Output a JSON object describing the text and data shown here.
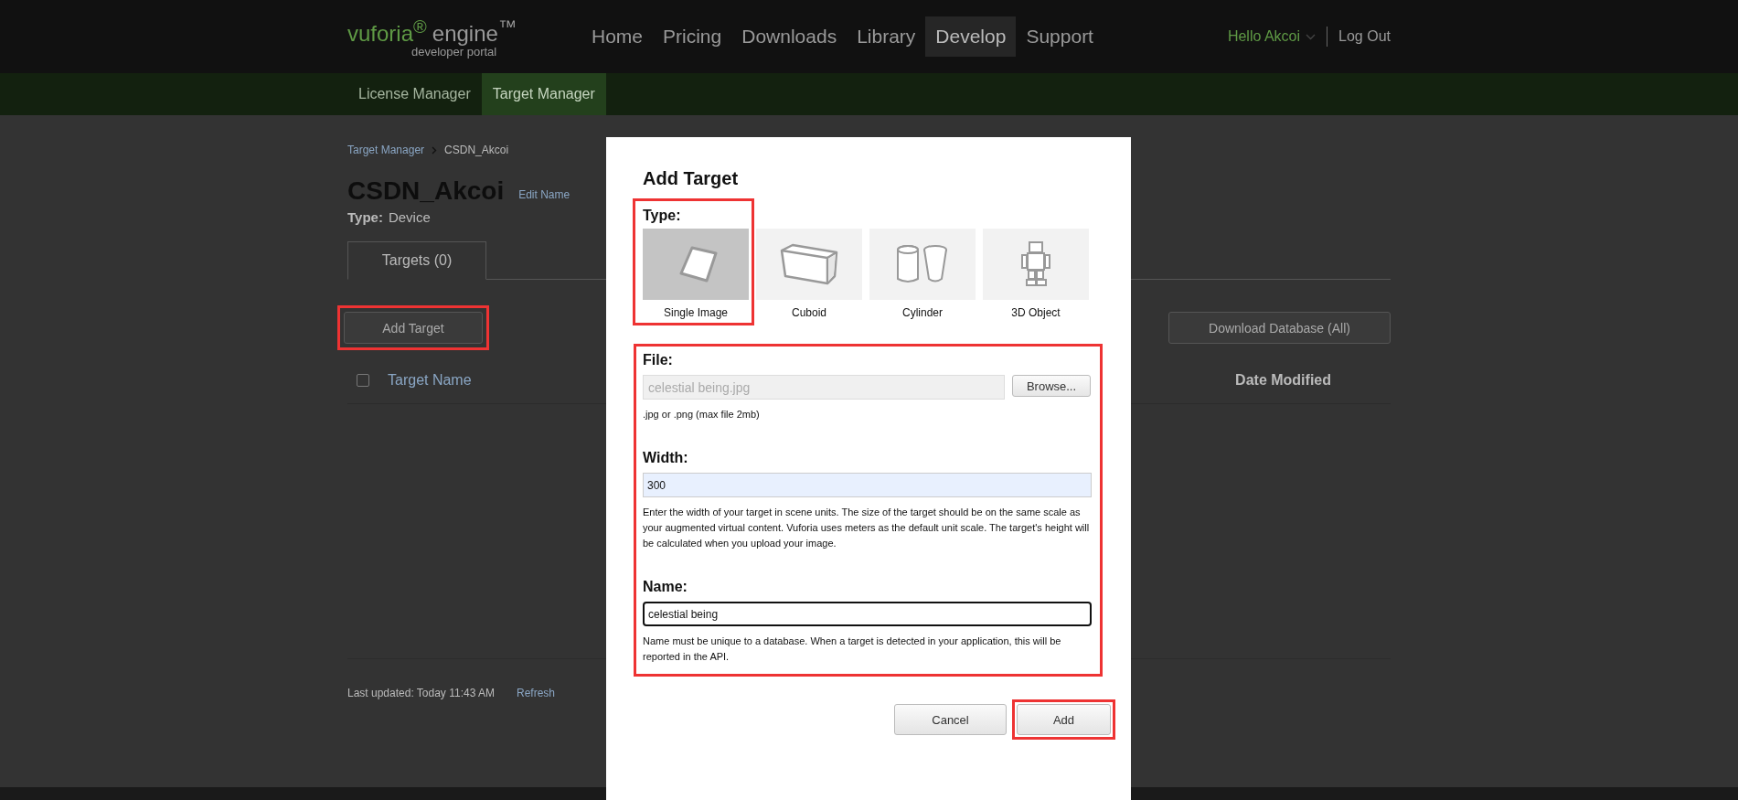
{
  "header": {
    "logo": {
      "brand": "vuforia$^{®}$",
      "product": "engine$^{™}$",
      "tagline": "developer portal"
    },
    "nav": [
      {
        "label": "Home",
        "selected": false
      },
      {
        "label": "Pricing",
        "selected": false
      },
      {
        "label": "Downloads",
        "selected": false
      },
      {
        "label": "Library",
        "selected": false
      },
      {
        "label": "Develop",
        "selected": true
      },
      {
        "label": "Support",
        "selected": false
      }
    ],
    "user": "Hello Akcoi",
    "logout": "Log Out"
  },
  "subnav": [
    {
      "label": "License Manager",
      "selected": false
    },
    {
      "label": "Target Manager",
      "selected": true
    }
  ],
  "breadcrumb": [
    "Target Manager",
    "CSDN_Akcoi"
  ],
  "database": {
    "name": "CSDN_Akcoi",
    "edit_link": "Edit Name",
    "type_label": "Type:",
    "type_value": "Device"
  },
  "tabs": [
    {
      "label": "Targets (0)",
      "selected": true
    }
  ],
  "add_button": {
    "label": "Add Target",
    "highlighted": true
  },
  "download_button": "Download Database (All)",
  "table": {
    "select_all_checked": false,
    "columns": [
      "Target Name",
      "Date Modified"
    ]
  },
  "last_updated": "Last updated: Today 11:43 AM",
  "refresh": "Refresh",
  "dialog": {
    "title": "Add Target",
    "type_label": "Type:",
    "type_highlighted": true,
    "types": [
      {
        "kind": "image",
        "label": "Single Image",
        "selected": true
      },
      {
        "kind": "cuboid",
        "label": "Cuboid",
        "selected": false
      },
      {
        "kind": "cylinder",
        "label": "Cylinder",
        "selected": false
      },
      {
        "kind": "object",
        "label": "3D Object",
        "selected": false
      }
    ],
    "fields_highlighted": true,
    "file": {
      "label": "File:",
      "value": "celestial being.jpg",
      "browse": "Browse...",
      "hint": ".jpg or .png (max file 2mb)"
    },
    "width": {
      "label": "Width:",
      "value": "300",
      "hint": "Enter the width of your target in scene units. The size of the target should be on the same scale as your augmented virtual content. Vuforia uses meters as the default unit scale. The target's height will be calculated when you upload your image."
    },
    "name": {
      "label": "Name:",
      "value": "celestial being",
      "hint": "Name must be unique to a database. When a target is detected in your application, this will be reported in the API."
    },
    "buttons": [
      {
        "kind": "cancel",
        "label": "Cancel",
        "highlighted": false
      },
      {
        "kind": "add",
        "label": "Add",
        "highlighted": true
      }
    ]
  }
}
